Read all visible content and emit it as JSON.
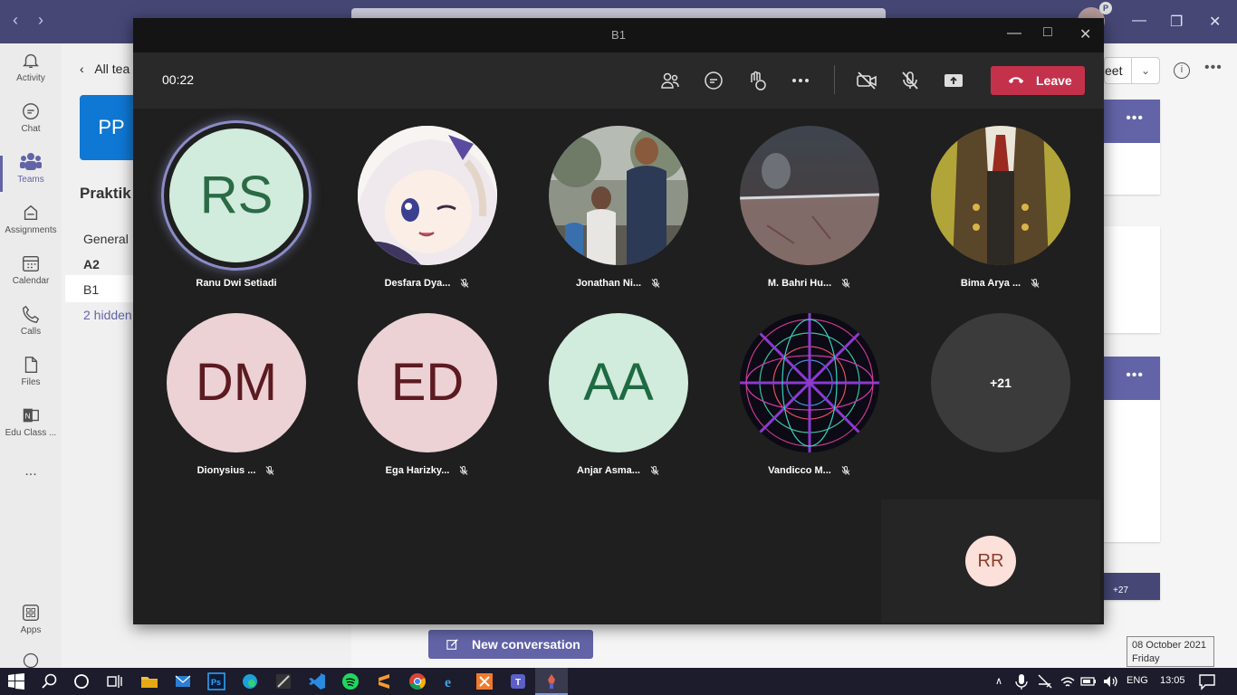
{
  "teams": {
    "rail": [
      {
        "label": "Activity",
        "icon": "bell-icon"
      },
      {
        "label": "Chat",
        "icon": "chat-icon"
      },
      {
        "label": "Teams",
        "icon": "teams-icon",
        "active": true
      },
      {
        "label": "Assignments",
        "icon": "assignments-icon"
      },
      {
        "label": "Calendar",
        "icon": "calendar-icon"
      },
      {
        "label": "Calls",
        "icon": "phone-icon"
      },
      {
        "label": "Files",
        "icon": "file-icon"
      },
      {
        "label": "Edu Class ...",
        "icon": "onenote-icon"
      }
    ],
    "rail_more": "...",
    "apps_label": "Apps",
    "back_label": "All tea",
    "team_initials": "PP",
    "team_name": "Praktik",
    "channels": [
      "General",
      "A2",
      "B1",
      "2 hidden"
    ],
    "meet_label": "eet",
    "new_conversation": "New conversation",
    "card_badge": "+27"
  },
  "meeting": {
    "window_title": "B1",
    "timer": "00:22",
    "leave_label": "Leave",
    "participants": [
      {
        "name": "Ranu Dwi Setiadi",
        "initials": "RS",
        "muted": false,
        "speaking": true
      },
      {
        "name": "Desfara Dya...",
        "photo": "anime-avatar",
        "muted": true
      },
      {
        "name": "Jonathan Ni...",
        "photo": "outdoor-photo",
        "muted": true
      },
      {
        "name": "M. Bahri Hu...",
        "photo": "glass-photo",
        "muted": true
      },
      {
        "name": "Bima Arya ...",
        "photo": "suit-avatar",
        "muted": true
      },
      {
        "name": "Dionysius ...",
        "initials": "DM",
        "muted": true
      },
      {
        "name": "Ega Harizky...",
        "initials": "ED",
        "muted": true
      },
      {
        "name": "Anjar Asma...",
        "initials": "AA",
        "muted": true
      },
      {
        "name": "Vandicco M...",
        "photo": "pattern-avatar",
        "muted": true
      }
    ],
    "overflow": "+21",
    "self_initials": "RR"
  },
  "tooltip": {
    "date": "08 October 2021",
    "day": "Friday"
  },
  "taskbar": {
    "lang": "ENG",
    "time": "13:05"
  },
  "colors": {
    "teams_purple": "#6264a7",
    "leave_red": "#c4314b",
    "green_avatar": "#d1ebdd",
    "pink_avatar": "#ecd2d5"
  }
}
